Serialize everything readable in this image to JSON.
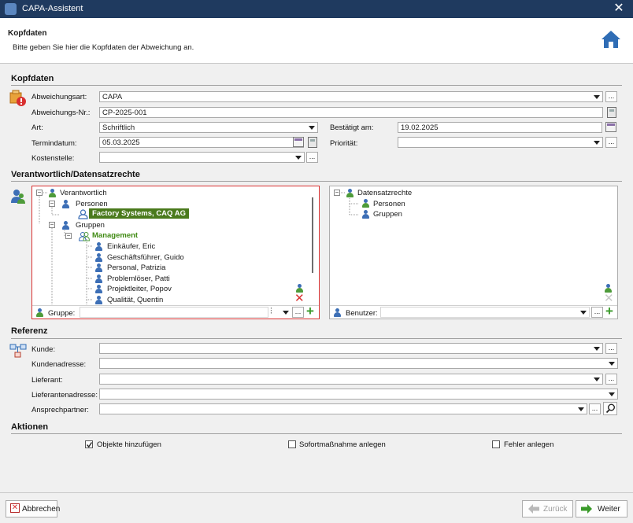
{
  "window": {
    "title": "CAPA-Assistent"
  },
  "header": {
    "title": "Kopfdaten",
    "subtitle": "Bitte geben Sie hier die Kopfdaten der Abweichung an."
  },
  "kopfdaten": {
    "section": "Kopfdaten",
    "abweichungsart_label": "Abweichungsart:",
    "abweichungsart_value": "CAPA",
    "abweichungsnr_label": "Abweichungs-Nr.:",
    "abweichungsnr_value": "CP-2025-001",
    "art_label": "Art:",
    "art_value": "Schriftlich",
    "bestaetigt_label": "Bestätigt am:",
    "bestaetigt_value": "19.02.2025",
    "termindatum_label": "Termindatum:",
    "termindatum_value": "05.03.2025",
    "prioritaet_label": "Priorität:",
    "prioritaet_value": "",
    "kostenstelle_label": "Kostenstelle:",
    "kostenstelle_value": ""
  },
  "verantwortlich": {
    "section": "Verantwortlich/Datensatzrechte",
    "tree": {
      "root": "Verantwortlich",
      "personen": "Personen",
      "person_selected": "Factory Systems, CAQ AG",
      "gruppen": "Gruppen",
      "management": "Management",
      "members": [
        "Einkäufer, Eric",
        "Geschäftsführer, Guido",
        "Personal, Patrizia",
        "Problemlöser, Patti",
        "Projektleiter, Popov",
        "Qualität, Quentin"
      ]
    },
    "gruppe_label": "Gruppe:",
    "rights_tree": {
      "root": "Datensatzrechte",
      "personen": "Personen",
      "gruppen": "Gruppen"
    },
    "benutzer_label": "Benutzer:"
  },
  "referenz": {
    "section": "Referenz",
    "kunde_label": "Kunde:",
    "kundenadresse_label": "Kundenadresse:",
    "lieferant_label": "Lieferant:",
    "lieferantenadresse_label": "Lieferantenadresse:",
    "ansprechpartner_label": "Ansprechpartner:"
  },
  "aktionen": {
    "section": "Aktionen",
    "objekte": {
      "label": "Objekte hinzufügen",
      "checked": true
    },
    "sofort": {
      "label": "Sofortmaßnahme anlegen",
      "checked": false
    },
    "fehler": {
      "label": "Fehler anlegen",
      "checked": false
    }
  },
  "footer": {
    "cancel": "Abbrechen",
    "back": "Zurück",
    "next": "Weiter"
  },
  "ellipsis": "...",
  "colors": {
    "titlebar": "#1f3a5f",
    "accent_red": "#d93030",
    "selected_bg": "#4a7a1c",
    "management_green": "#3f8a12",
    "add_green": "#3a9a2a",
    "home_blue": "#2f6db5"
  }
}
